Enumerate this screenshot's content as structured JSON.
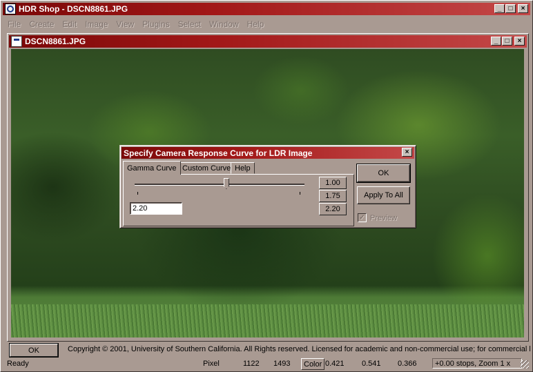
{
  "app": {
    "title": "HDR Shop - DSCN8861.JPG",
    "menu": [
      "File",
      "Create",
      "Edit",
      "Image",
      "View",
      "Plugins",
      "Select",
      "Window",
      "Help"
    ]
  },
  "child_window": {
    "title": "DSCN8861.JPG"
  },
  "dialog": {
    "title": "Specify Camera Response Curve for LDR Image",
    "tabs": [
      "Gamma Curve",
      "Custom Curve",
      "Help"
    ],
    "active_tab": "Gamma Curve",
    "gamma_value": "2.20",
    "slider_position": 0.54,
    "presets": [
      "1.00",
      "1.75",
      "2.20"
    ],
    "ok_label": "OK",
    "apply_all_label": "Apply To All",
    "preview_label": "Preview",
    "preview_checked": true
  },
  "footer": {
    "ok_label": "OK",
    "copyright": "Copyright © 2001, University of Southern California.  All Rights reserved.  Licensed for academic and non-commercial use; for commercial licen"
  },
  "status": {
    "ready": "Ready",
    "pixel_label": "Pixel",
    "pixel_x": "1122",
    "pixel_y": "1493",
    "color_label": "Color",
    "r": "0.421",
    "g": "0.541",
    "b": "0.366",
    "zoom": "+0.00 stops, Zoom 1 x"
  },
  "colors": {
    "title_active": "#8b0c0c",
    "face": "#a99a92"
  }
}
